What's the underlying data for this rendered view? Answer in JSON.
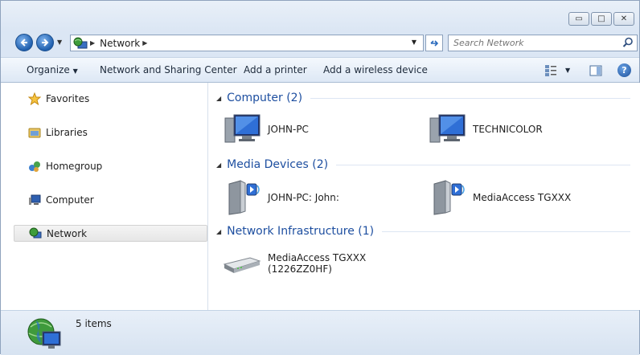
{
  "window": {
    "minimize_glyph": "▭",
    "maximize_glyph": "□",
    "close_glyph": "✕"
  },
  "address": {
    "path": "Network",
    "separator_glyph": "▶"
  },
  "search": {
    "placeholder": "Search Network"
  },
  "toolbar": {
    "organize_label": "Organize",
    "network_sharing_label": "Network and Sharing Center",
    "add_printer_label": "Add a printer",
    "add_wireless_label": "Add a wireless device",
    "help_glyph": "?"
  },
  "sidebar": {
    "items": [
      {
        "label": "Favorites",
        "icon": "star-icon"
      },
      {
        "label": "Libraries",
        "icon": "libraries-icon"
      },
      {
        "label": "Homegroup",
        "icon": "homegroup-icon"
      },
      {
        "label": "Computer",
        "icon": "computer-icon"
      },
      {
        "label": "Network",
        "icon": "network-icon",
        "selected": true
      }
    ]
  },
  "groups": [
    {
      "title": "Computer (2)",
      "items": [
        {
          "label": "JOHN-PC",
          "icon": "computer-monitor-icon"
        },
        {
          "label": "TECHNICOLOR",
          "icon": "computer-monitor-icon"
        }
      ]
    },
    {
      "title": "Media Devices (2)",
      "items": [
        {
          "label": "JOHN-PC: John:",
          "icon": "media-device-icon"
        },
        {
          "label": "MediaAccess TGXXX",
          "icon": "media-device-icon"
        }
      ]
    },
    {
      "title": "Network Infrastructure (1)",
      "items": [
        {
          "label_line1": "MediaAccess TGXXX",
          "label_line2": "(1226ZZ0HF)",
          "icon": "router-icon"
        }
      ]
    }
  ],
  "status": {
    "item_count": "5 items"
  },
  "colors": {
    "group_title": "#1e4fa0",
    "selection_bg": "#e6e6e6"
  }
}
